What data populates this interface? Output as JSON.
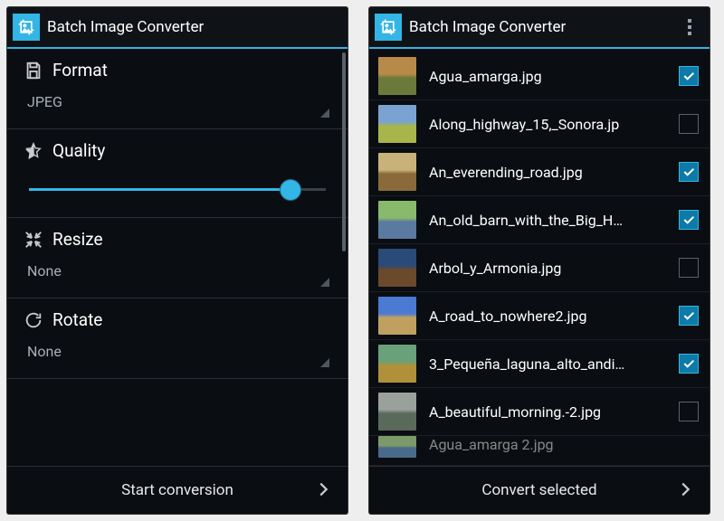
{
  "app_title": "Batch Image Converter",
  "left": {
    "format": {
      "title": "Format",
      "value": "JPEG"
    },
    "quality": {
      "title": "Quality",
      "value_pct": 88
    },
    "resize": {
      "title": "Resize",
      "value": "None"
    },
    "rotate": {
      "title": "Rotate",
      "value": "None"
    },
    "action": "Start conversion"
  },
  "right": {
    "files": [
      {
        "name": "Agua_amarga.jpg",
        "checked": true,
        "g": [
          "#b88a4a",
          "#6b7a3a"
        ]
      },
      {
        "name": "Along_highway_15,_Sonora.jp",
        "checked": false,
        "g": [
          "#7aa3d1",
          "#a8b54a"
        ]
      },
      {
        "name": "An_everending_road.jpg",
        "checked": true,
        "g": [
          "#c9b27a",
          "#8a6a3a"
        ]
      },
      {
        "name": "An_old_barn_with_the_Big_H…",
        "checked": true,
        "g": [
          "#89b96a",
          "#5a7aa0"
        ]
      },
      {
        "name": "Arbol_y_Armonia.jpg",
        "checked": false,
        "g": [
          "#2a4a7a",
          "#6a4a2a"
        ]
      },
      {
        "name": "A_road_to_nowhere2.jpg",
        "checked": true,
        "g": [
          "#4a7ad1",
          "#c0a060"
        ]
      },
      {
        "name": "3_Pequeña_laguna_alto_andi…",
        "checked": true,
        "g": [
          "#6aa07a",
          "#b0903a"
        ]
      },
      {
        "name": "A_beautiful_morning.-2.jpg",
        "checked": false,
        "g": [
          "#9aa09a",
          "#5a6a5a"
        ]
      },
      {
        "name": "Agua_amarga 2.jpg",
        "checked": true,
        "g": [
          "#7a9a6a",
          "#4a6a8a"
        ],
        "partial": true
      }
    ],
    "action": "Convert selected"
  },
  "icons": {
    "app": "crop-image-icon",
    "format": "save-icon",
    "quality": "star-half-icon",
    "resize": "collapse-icon",
    "rotate": "rotate-icon",
    "overflow": "overflow-menu-icon",
    "chevron": "chevron-right-icon",
    "check": "checkmark-icon"
  }
}
